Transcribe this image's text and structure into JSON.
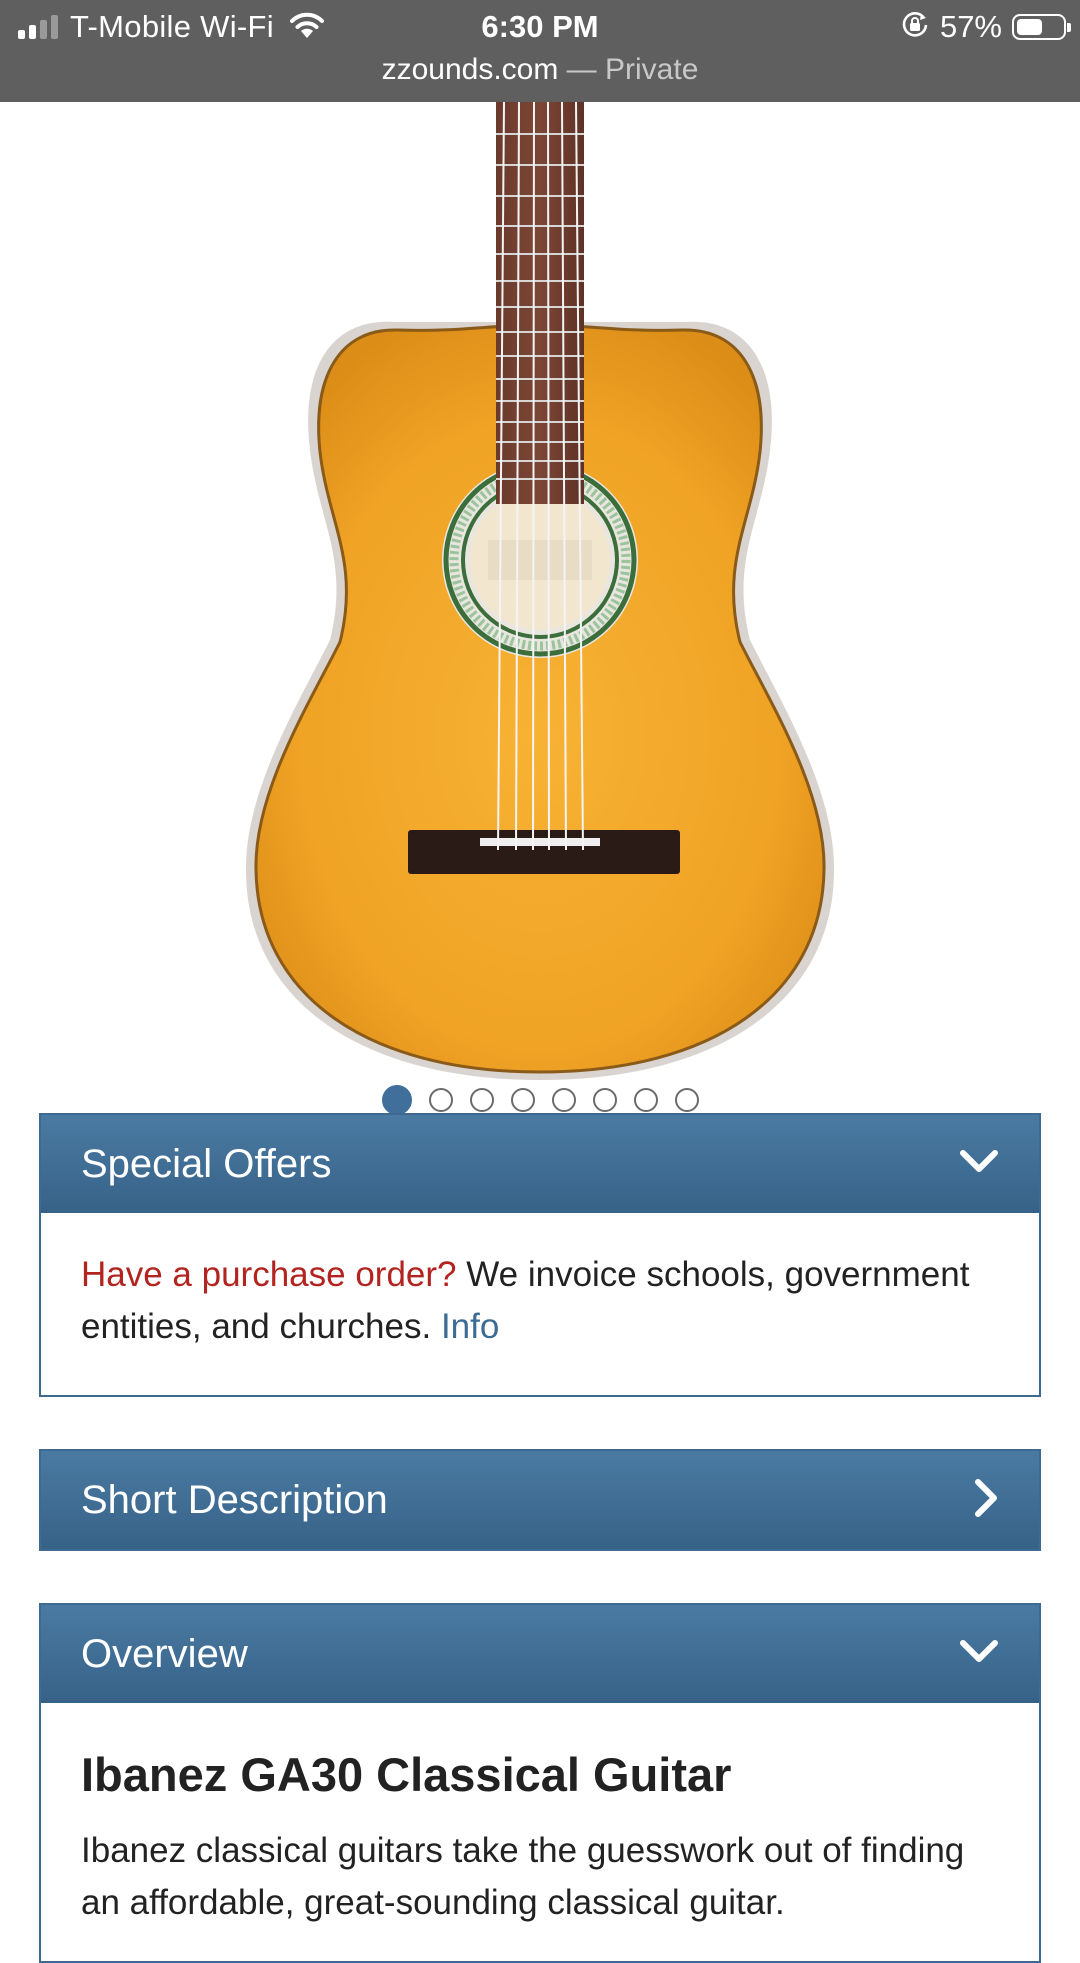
{
  "status_bar": {
    "carrier": "T-Mobile Wi-Fi",
    "time": "6:30 PM",
    "battery_percent": "57%",
    "battery_level": 0.57
  },
  "browser": {
    "domain": "zzounds.com",
    "separator": " — ",
    "mode": "Private"
  },
  "carousel": {
    "total": 8,
    "active_index": 0
  },
  "special_offers": {
    "title": "Special Offers",
    "icon": "chevron-down-icon",
    "po_link": "Have a purchase order?",
    "po_text": "We invoice schools, government entities, and churches.",
    "info_link": "Info"
  },
  "short_description": {
    "title": "Short Description",
    "icon": "chevron-right-icon"
  },
  "overview": {
    "title": "Overview",
    "icon": "chevron-down-icon",
    "heading": "Ibanez GA30 Classical Guitar",
    "text": "Ibanez classical guitars take the guesswork out of finding an affordable, great-sounding classical guitar."
  },
  "colors": {
    "accent": "#3f6f9a",
    "header_top": "#4a7aa2",
    "header_bottom": "#376288",
    "link_red": "#b3231f",
    "guitar_body": "#f0a325"
  }
}
